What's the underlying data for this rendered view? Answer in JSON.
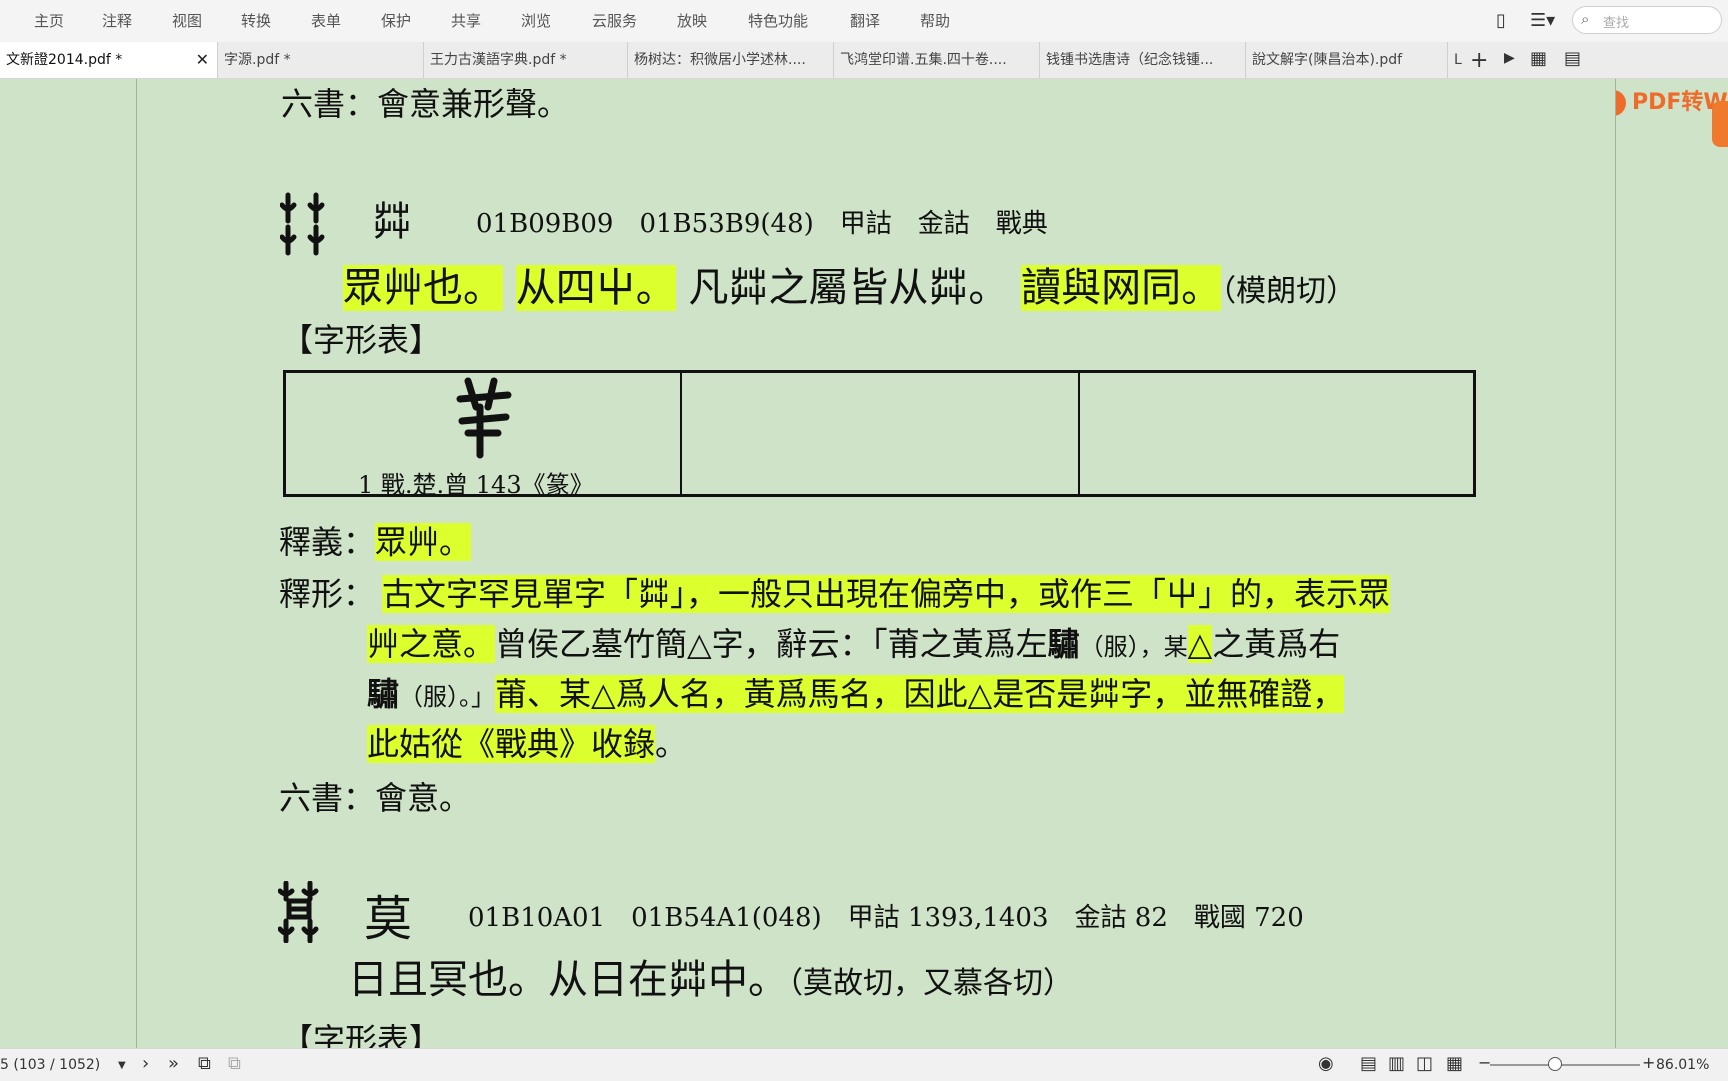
{
  "menu": [
    "主页",
    "注释",
    "视图",
    "转换",
    "表单",
    "保护",
    "共享",
    "浏览",
    "云服务",
    "放映",
    "特色功能",
    "翻译",
    "帮助"
  ],
  "search_placeholder": "查找",
  "tabs": [
    {
      "label": "文新證2014.pdf *",
      "active": true
    },
    {
      "label": "字源.pdf *"
    },
    {
      "label": "王力古漢語字典.pdf *"
    },
    {
      "label": "杨树达：积微居小学述林...."
    },
    {
      "label": "飞鸿堂印谱.五集.四十卷...."
    },
    {
      "label": "钱锺书选唐诗（纪念钱锺..."
    },
    {
      "label": "說文解字(陳昌治本).pdf"
    },
    {
      "label": "L"
    }
  ],
  "pdf_button": "PDF转W",
  "icons": {
    "tab_close": "close-icon",
    "add_tab": "plus-icon",
    "tab_more": "play-icon",
    "grid": "grid-icon",
    "list": "list-icon",
    "phone": "phone-icon",
    "text_select": "text-select-icon",
    "search": "search-icon"
  },
  "doc": {
    "line_top": "六書：會意兼形聲。",
    "entry1": {
      "head_char": "茻",
      "codes": "01B09B09　01B53B9(48)　甲詁　金詁　戰典",
      "def_seg1": "眾艸也。",
      "def_seg2": "从四屮。",
      "def_seg3": "凡茻之屬皆从茻。",
      "def_seg4": "讀與网同。",
      "def_seg5": "（模朗切）",
      "table_title": "【字形表】",
      "table_cell1_label": "1 戰.楚.曾 143《篆》",
      "shiyi_label": "釋義：",
      "shiyi_text": "眾艸。",
      "shixing_label": "釋形：",
      "shixing_l1": "古文字罕見單字「茻」，一般只出現在偏旁中，或作三「屮」的，表示眾",
      "shixing_l2a": "艸之意。",
      "shixing_l2b": "曾侯乙墓竹簡△字，辭云：「莆之黃爲左",
      "shixing_l2c": "驌",
      "shixing_l2d": "（服），某",
      "shixing_l2e": "△",
      "shixing_l2f": "之黃爲右",
      "shixing_l3a": "驌",
      "shixing_l3b": "（服）。」",
      "shixing_l3c": "莆、某△爲人名，黃爲馬名，因此△是否是茻字，並無確證，",
      "shixing_l4a": "此姑從《戰典》收錄",
      "shixing_l4b": "。",
      "liushu": "六書：會意。"
    },
    "entry2": {
      "head_char": "莫",
      "codes": "01B10A01　01B54A1(048)　甲詁 1393,1403　金詁 82　戰國 720",
      "def": "日且冥也。从日在茻中。",
      "def_end": "（莫故切，又慕各切）",
      "table_title": "【字形表】"
    }
  },
  "status": {
    "page": "5 (103 / 1052)",
    "zoom": "86.01%"
  },
  "colors": {
    "page_bg": "#cfe3c8",
    "highlight": "#dcff2e",
    "accent": "#ef6b2a"
  }
}
